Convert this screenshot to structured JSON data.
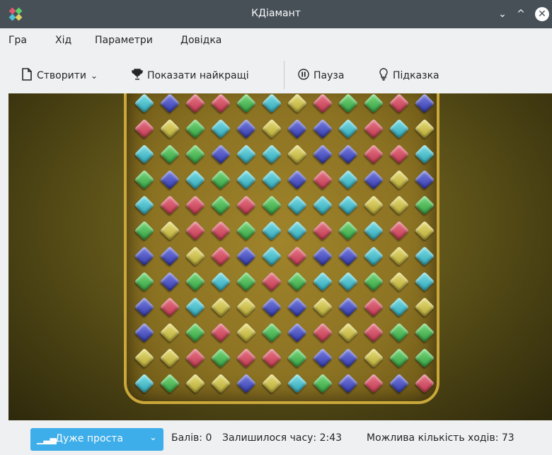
{
  "window": {
    "title": "КДіамант"
  },
  "titlebar": {
    "minimize_glyph": "⌄",
    "maximize_glyph": "^",
    "close_glyph": "✕"
  },
  "menu": [
    {
      "label": "Гра"
    },
    {
      "label": "Хід"
    },
    {
      "label": "Параметри"
    },
    {
      "label": "Довідка"
    }
  ],
  "toolbar": {
    "new_label": "Створити",
    "highscores_label": "Показати найкращі",
    "pause_label": "Пауза",
    "hint_label": "Підказка"
  },
  "icons": {
    "new": "document-new-icon",
    "highscores": "trophy-icon",
    "pause": "pause-icon",
    "hint": "lightbulb-icon"
  },
  "board": {
    "rows": [
      "cbrrgcyrggrb",
      "rygcbybbcrcy",
      "cggbccybbrrc",
      "gbcgccbrcbyb",
      "crrgrgcccyyg",
      "gyrrgccrgcry",
      "bbyrbcrbbcyc",
      "gbgcgrgccgyc",
      "brcyybbybrcy",
      "bygrygbryrgg",
      "yyrgrrgbbygg",
      "cgyybycgbrbr"
    ]
  },
  "status": {
    "difficulty": "Дуже проста",
    "score": "Балів: 0",
    "time_left": "Залишилося часу: 2:43",
    "moves": "Можлива кількість ходів: 73"
  },
  "colors": {
    "titlebar": "#475057",
    "accent": "#3daee9",
    "board_frame": "#c9a73a"
  }
}
